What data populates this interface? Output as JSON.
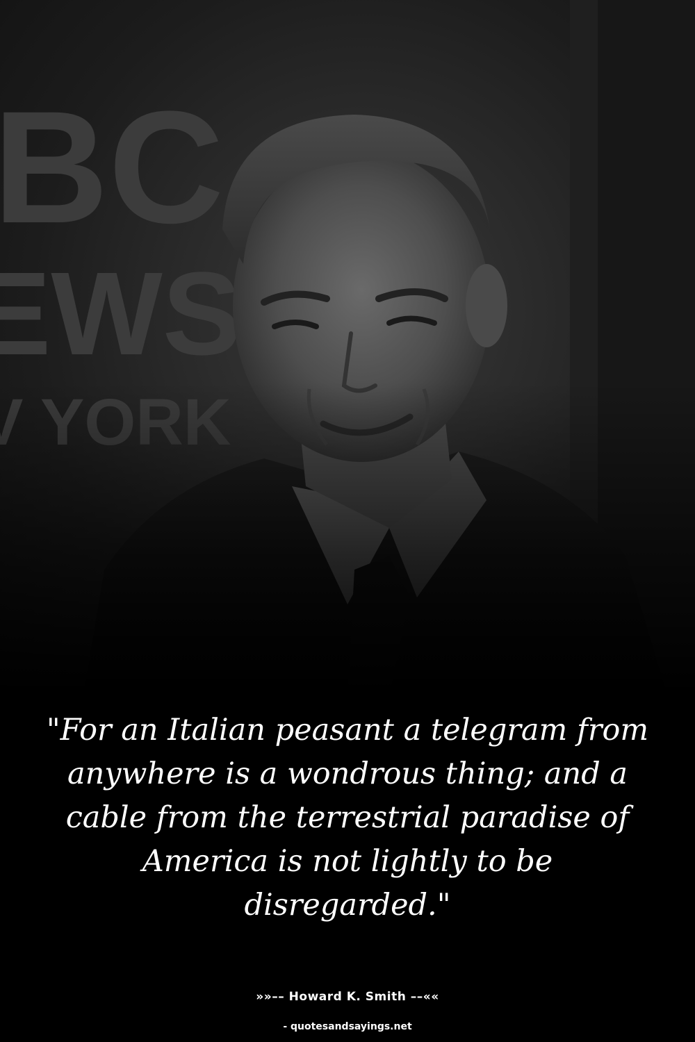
{
  "background": {
    "color": "#000000",
    "photo_description_icon": "portrait-photo"
  },
  "backdrop_sign": {
    "line1": "BC",
    "line2": "EWS",
    "line3": "V YORK"
  },
  "quote": {
    "text": "\"For an Italian peasant a telegram from anywhere is a wondrous thing; and a cable from the terrestrial paradise of America is not lightly to be disregarded.\""
  },
  "attribution": {
    "author_line": "»»–– Howard K. Smith ––««"
  },
  "footer": {
    "source": "- quotesandsayings.net"
  }
}
